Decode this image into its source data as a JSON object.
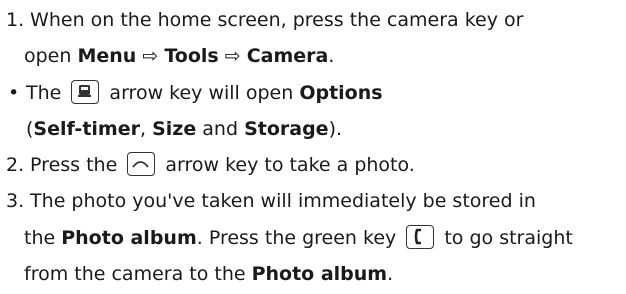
{
  "step1": {
    "number": "1.",
    "text_a": "When on the home screen, press the camera key or",
    "text_b": "open ",
    "menu": "Menu",
    "arrow": "⇨",
    "tools": "Tools",
    "camera": "Camera",
    "period": "."
  },
  "bullet": {
    "symbol": "•",
    "text_a": "The ",
    "text_b": " arrow key will open ",
    "options": "Options",
    "paren_open": "(",
    "self_timer": "Self-timer",
    "comma": ", ",
    "size": "Size",
    "and": " and ",
    "storage": "Storage",
    "paren_close": ")."
  },
  "step2": {
    "number": "2.",
    "text_a": "Press the ",
    "text_b": " arrow key to take a photo."
  },
  "step3": {
    "number": "3.",
    "text_a": "The photo you've taken will immediately be stored in",
    "text_b": "the ",
    "photo_album": "Photo album",
    "text_c": ". Press the green key ",
    "text_d": " to go straight",
    "text_e": "from the camera to the ",
    "photo_album_2": "Photo album",
    "period": "."
  },
  "icons": [
    "camera-key-icon",
    "up-arrow-key-icon",
    "green-call-key-icon"
  ]
}
